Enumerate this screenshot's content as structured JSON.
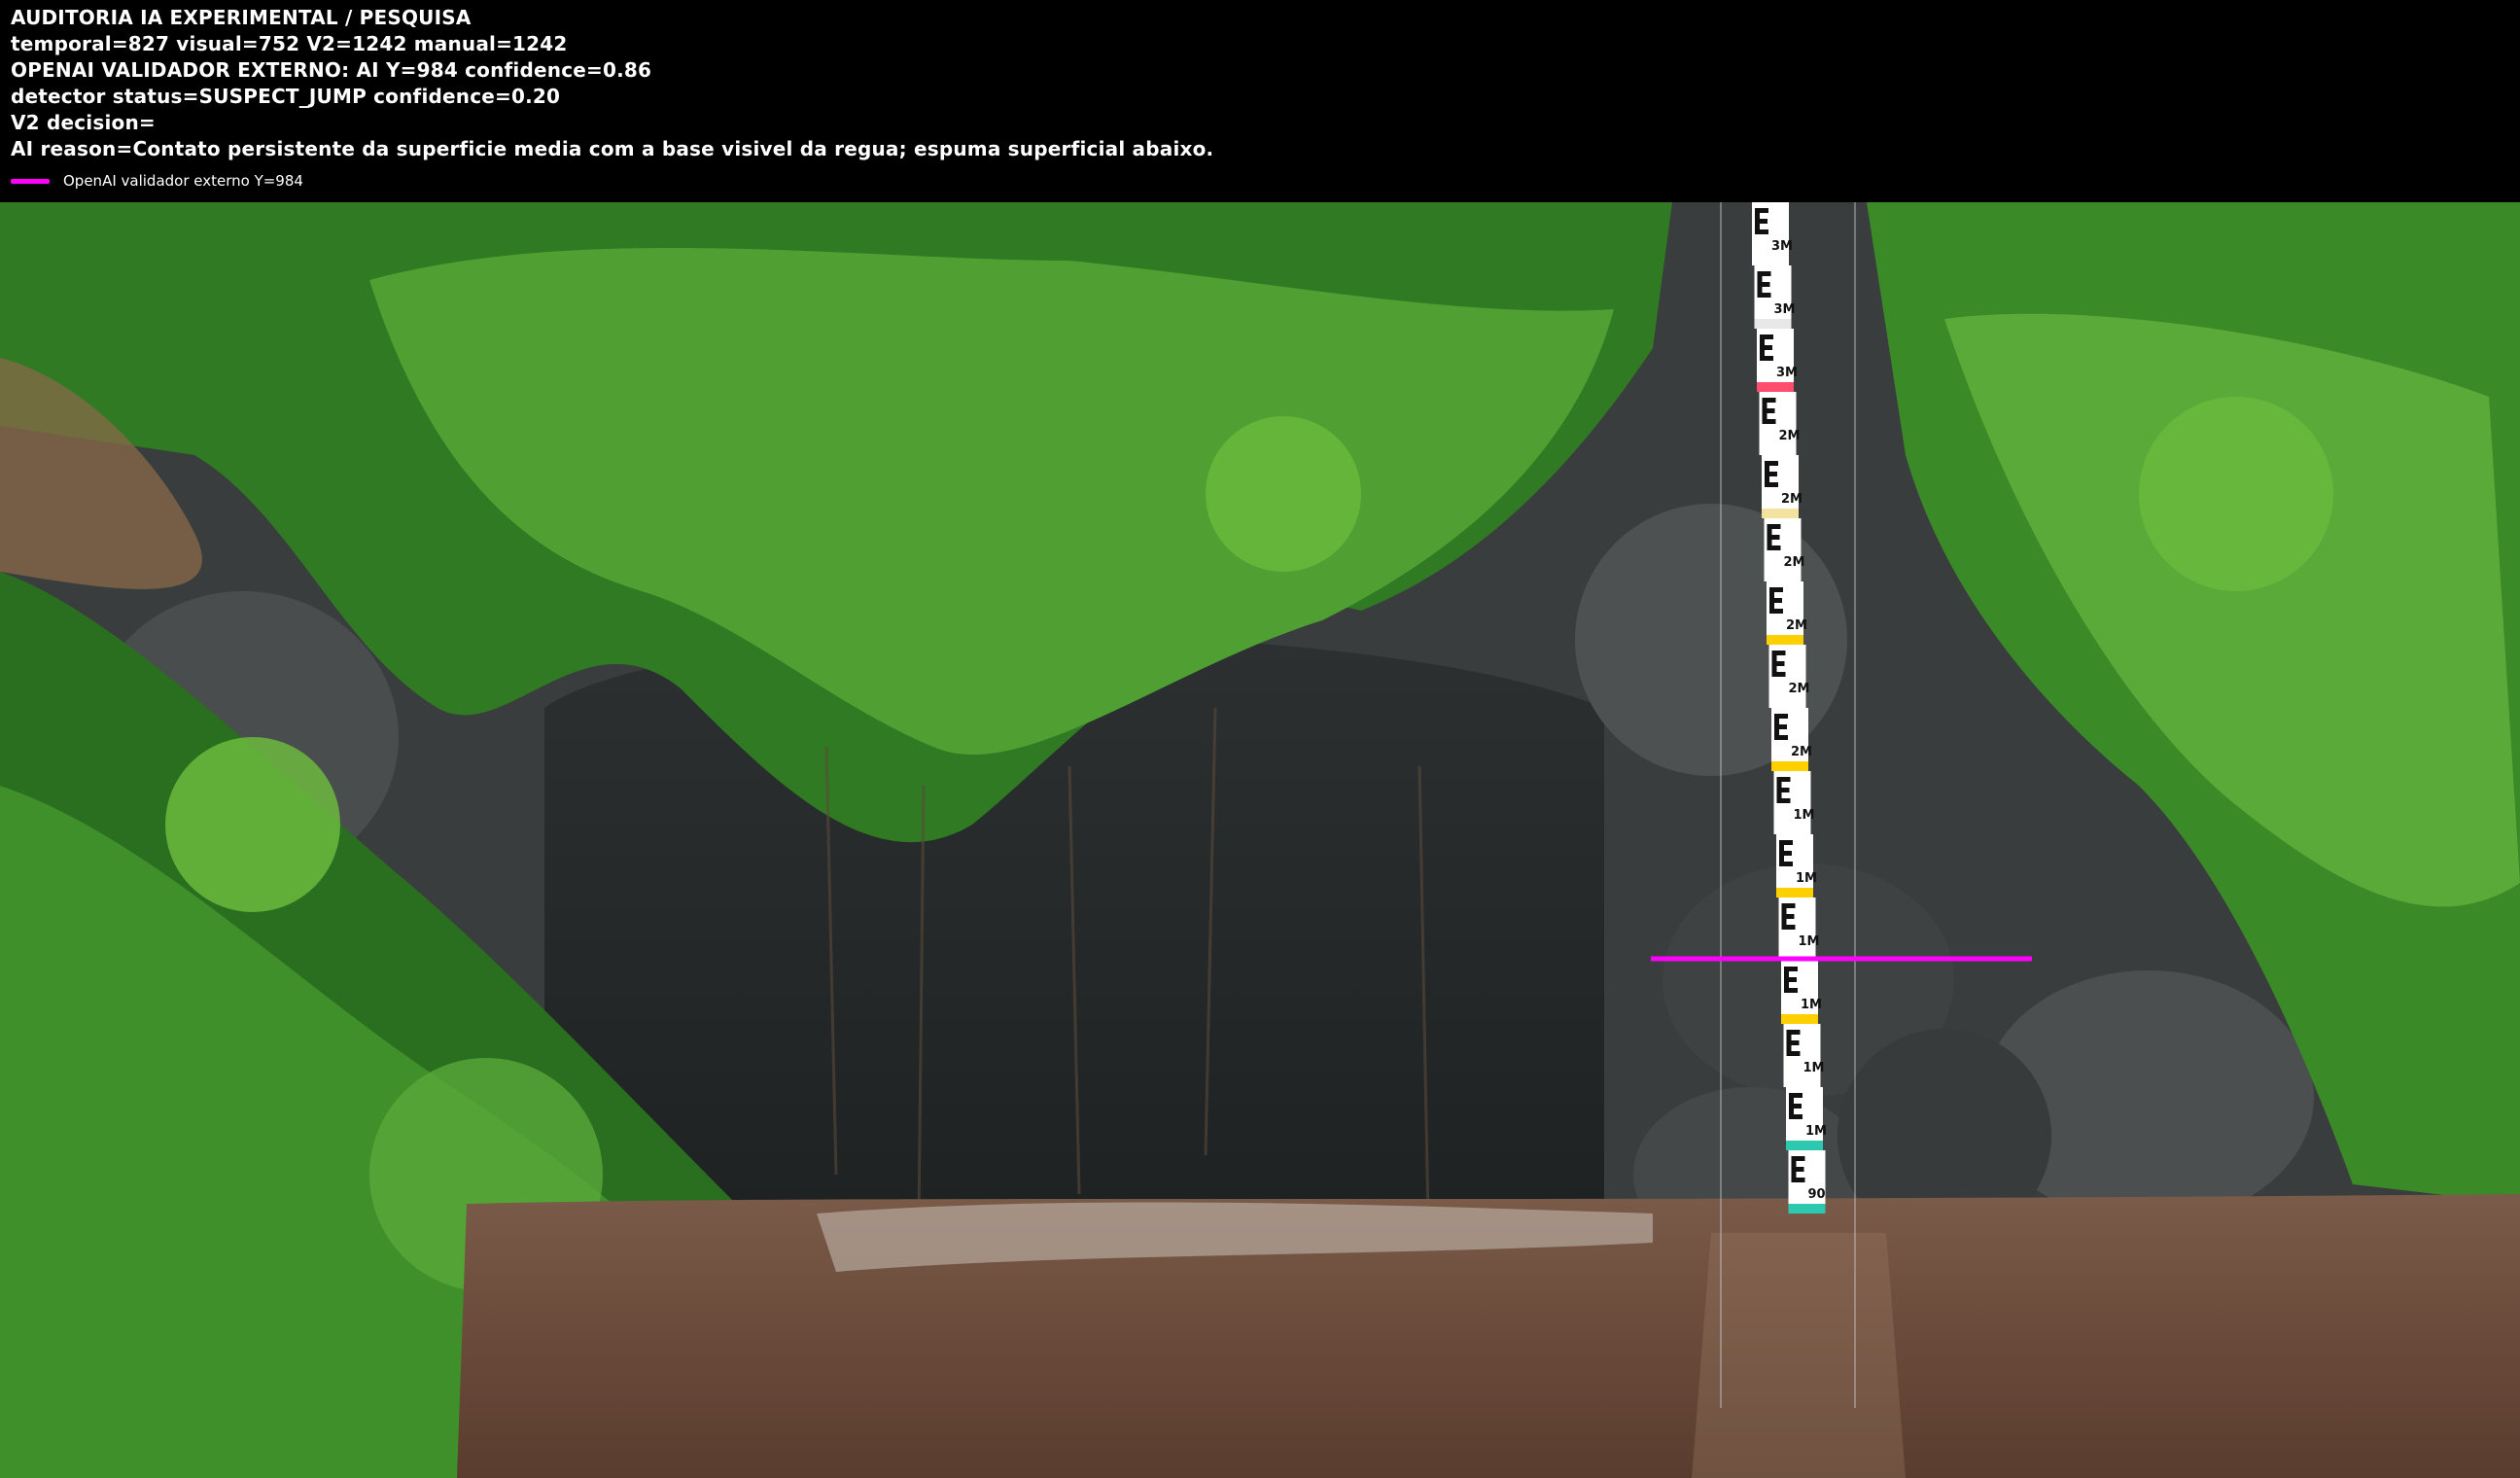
{
  "header": {
    "lines": [
      "AUDITORIA IA  EXPERIMENTAL / PESQUISA",
      "temporal=827  visual=752  V2=1242  manual=1242",
      "OPENAI  VALIDADOR EXTERNO: AI Y=984  confidence=0.86",
      "detector status=SUSPECT_JUMP confidence=0.20",
      "V2 decision=",
      "AI reason=Contato persistente da superficie media com a base visivel da regua; espuma superficial abaixo."
    ],
    "legend": {
      "label": "OpenAI validador externo Y=984",
      "color": "#ff00ff"
    }
  },
  "overlay": {
    "validator_line_color": "#ff00ff",
    "validator_y": 984
  },
  "gauge": {
    "labels": [
      "3M",
      "3M",
      "3M",
      "2M",
      "2M",
      "2M",
      "2M",
      "2M",
      "2M",
      "1M",
      "1M",
      "1M",
      "1M",
      "1M",
      "1M",
      "90"
    ],
    "band_colors": [
      "#ffffff",
      "#e8e8e8",
      "#ff4d6d",
      "#ffffff",
      "#f3e2a0",
      "#ffffff",
      "#ffd000",
      "#ffffff",
      "#ffd000",
      "#ffffff",
      "#ffd000",
      "#ffffff",
      "#ffd000",
      "#ffffff",
      "#2cc8b0",
      "#2cc8b0"
    ]
  },
  "colors": {
    "water": "#6b4a3a",
    "rock": "#3f4242",
    "foliage": "#3f8f2a",
    "foliage_light": "#6fbf3f"
  }
}
